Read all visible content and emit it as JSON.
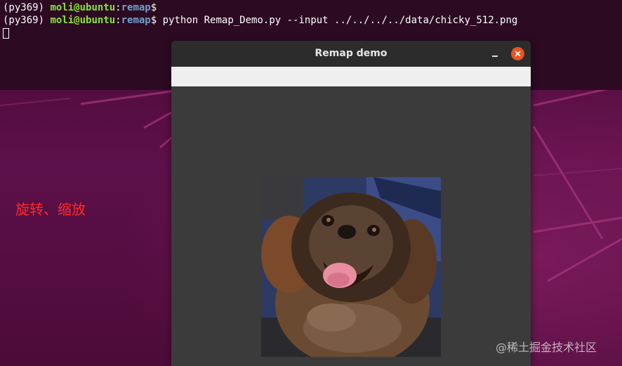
{
  "terminal": {
    "line1": {
      "prefix": "(py369) ",
      "user": "moli@ubuntu",
      "colon": ":",
      "path": "remap",
      "suffix": "$"
    },
    "line2": {
      "prefix": "(py369) ",
      "user": "moli@ubuntu",
      "colon": ":",
      "path": "remap",
      "suffix": "$ ",
      "command": "python Remap_Demo.py --input ../../../../data/chicky_512.png"
    }
  },
  "annotation": {
    "text": "旋转、缩放"
  },
  "window": {
    "title": "Remap demo"
  },
  "watermark": {
    "text": "@稀土掘金技术社区"
  },
  "colors": {
    "accent_close": "#e95420",
    "terminal_green": "#8ae234",
    "terminal_blue": "#729fcf",
    "annotation_red": "#ff2a2a"
  }
}
